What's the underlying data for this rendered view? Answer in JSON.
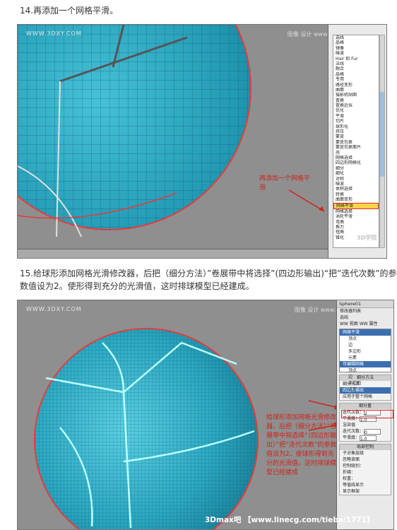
{
  "step14": {
    "text": "14.再添加一个网格平滑。"
  },
  "step15": {
    "text": "15.给球形添加网格光滑修改器，后把（细分方法）”卷展带中将选择”(四边形输出)“把”迭代次数”的参数值设为2。使形得到充分的光滑值，这时排球模型已经建成。"
  },
  "shot1": {
    "watermark": "WWW.3DXY.COM",
    "brand": "图像 设计 www.PSKA.COM",
    "modifiers": [
      "选线",
      "晶格",
      "镜像",
      "噪波",
      "Hair 和 Fur",
      "法线",
      "融合",
      "晶格",
      "专用",
      "路径变形",
      "曲面",
      "摄影机贴图",
      "置换",
      "置换近似",
      "优化",
      "平滑",
      "切片",
      "球形化",
      "挤压",
      "蒙皮",
      "蒙皮包裹",
      "蒙皮包裹面片",
      "壳",
      "网格选择",
      "四边形网格化",
      "细分",
      "细化",
      "对称",
      "噪波",
      "体积选择",
      "转换",
      "曲面变形",
      "网格平滑",
      "网格选择",
      "涡轮平滑",
      "弯曲",
      "推力",
      "扭曲",
      "锥化"
    ],
    "selected_index": 32,
    "note": "再添加一个网格平滑",
    "logo": "3D学院"
  },
  "shot2": {
    "watermark": "WWW.3DXY.COM",
    "brand": "图像 设计 www.PSKA.COM",
    "panel": {
      "object": "Sphere01",
      "modifier_list": "修改器列表",
      "tab_a": "选线",
      "tab_b": "WW 视图",
      "tab_c": "WW 属性",
      "stack": [
        "网格平滑",
        "顶点",
        "边",
        "多边形",
        "元素",
        "可编辑网格",
        "顶点",
        "边",
        "多边形",
        "元素"
      ],
      "subdiv_method_title": "细分方法",
      "subdiv_method_label": "细分方法：",
      "subdiv_method_value": "四边形输出",
      "apply_whole": "应用于整个网格",
      "subdiv_amount_title": "细分量",
      "iterations_label": "迭代次数：",
      "iterations_value": "2",
      "smoothness_label": "平滑度：",
      "smoothness_value": "1.0",
      "render_values": "渲染值",
      "render_iter_label": "迭代次数：",
      "render_iter_value": "0",
      "render_smooth_label": "平滑度：",
      "render_smooth_value": "1.0",
      "local_control_title": "局部控制",
      "sub_object_level": "子对象层级",
      "ignore_backface": "忽略背面",
      "control_level_label": "控制级别：",
      "crease_label": "折缝：",
      "weight_label": "权重：",
      "isoline": "等值线显示",
      "show_cage": "显示框架"
    },
    "note": "给球形添加网格光滑修改器，后把（细分方法）”卷展带中将选择”（四边形输出）”把”迭代次数”的参数值设为2。使球形得到充分的光滑值，这时排球模型已经建成",
    "footer": "3Dmax吧 【www.linecg.com/tieba/1771】",
    "logo": "3D学院"
  },
  "colors": {
    "ball": "#2fb0c8",
    "wire": "#e63b3b",
    "note": "#d0231a",
    "bg": "#8f8f8f"
  }
}
